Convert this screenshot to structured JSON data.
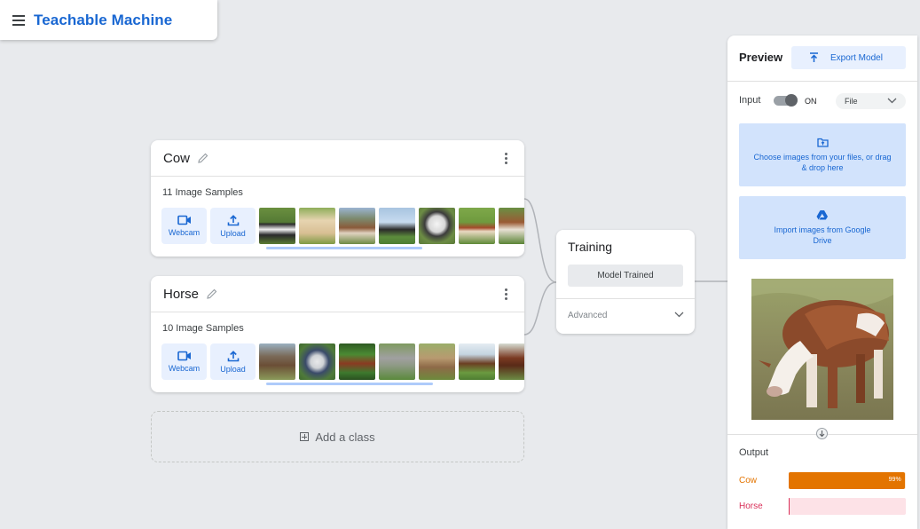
{
  "app": {
    "title": "Teachable Machine"
  },
  "classes": [
    {
      "name": "Cow",
      "samples_label": "11 Image Samples",
      "webcam_label": "Webcam",
      "upload_label": "Upload"
    },
    {
      "name": "Horse",
      "samples_label": "10 Image Samples",
      "webcam_label": "Webcam",
      "upload_label": "Upload"
    }
  ],
  "add_class": {
    "label": "Add a class"
  },
  "training": {
    "title": "Training",
    "button_label": "Model Trained",
    "advanced_label": "Advanced"
  },
  "preview": {
    "title": "Preview",
    "export_label": "Export Model",
    "input_label": "Input",
    "toggle_label": "ON",
    "input_source": "File",
    "upload_files_text": "Choose images from your files, or drag & drop here",
    "drive_text": "Import images from Google Drive",
    "output_label": "Output",
    "outputs": [
      {
        "label": "Cow",
        "value": 0.99,
        "value_text": "99%",
        "color": "#e37400",
        "bg": "#fce8d2"
      },
      {
        "label": "Horse",
        "value": 0.01,
        "value_text": "",
        "color": "#d93059",
        "bg": "#fde2e7"
      }
    ]
  },
  "colors": {
    "accent": "#1967d2",
    "cow_bar": "#e37400",
    "horse_bar": "#d93059"
  }
}
